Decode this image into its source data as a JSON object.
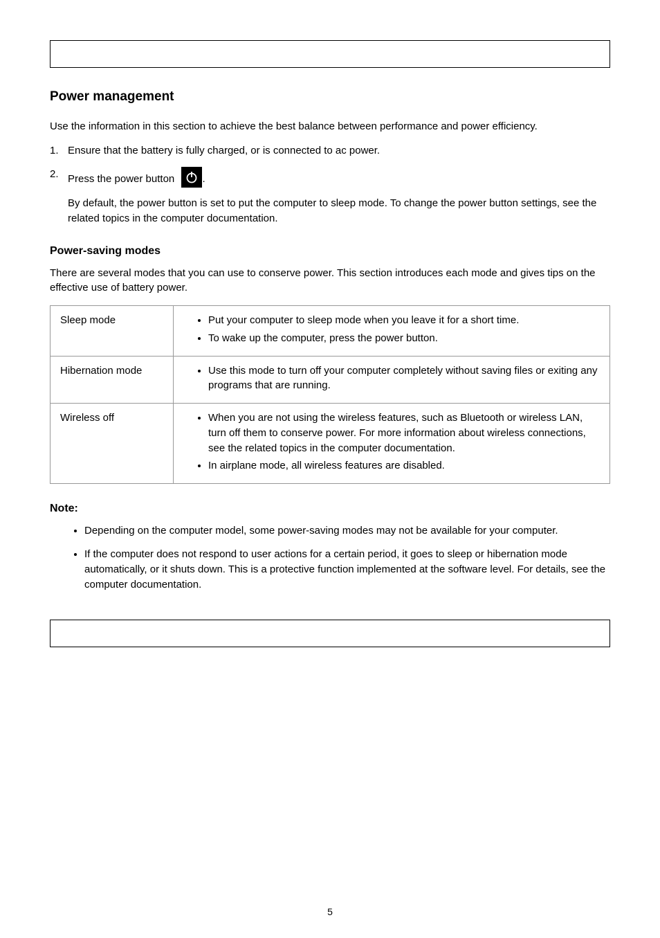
{
  "header_banner": "",
  "h1": "Power management",
  "intro": "Use the information in this section to achieve the best balance between performance and power efficiency.",
  "step1_num": "1.",
  "step1_txt": "Ensure that the battery is fully charged, or is connected to ac power.",
  "step2_num": "2.",
  "step2_label": "Press the power button ",
  "step2_tail": ".",
  "step2_indent": "By default, the power button is set to put the computer to sleep mode. To change the power button settings, see the related topics in the computer documentation.",
  "h2_modes": "Power-saving modes",
  "modes_intro": "There are several modes that you can use to conserve power. This section introduces each mode and gives tips on the effective use of battery power.",
  "table": {
    "rows": [
      {
        "label": "Sleep mode",
        "items": [
          "Put your computer to sleep mode when you leave it for a short time.",
          "To wake up the computer, press the power button."
        ]
      },
      {
        "label": "Hibernation mode",
        "items": [
          "Use this mode to turn off your computer completely without saving files or exiting any programs that are running."
        ]
      },
      {
        "label": "Wireless off",
        "items": [
          "When you are not using the wireless features, such as Bluetooth or wireless LAN, turn off them to conserve power. For more information about wireless connections, see the related topics in the computer documentation.",
          "In airplane mode, all wireless features are disabled."
        ]
      }
    ]
  },
  "h2_note": "Note:",
  "notes": [
    "Depending on the computer model, some power-saving modes may not be available for your computer.",
    "If the computer does not respond to user actions for a certain period, it goes to sleep or hibernation mode automatically, or it shuts down. This is a protective function implemented at the software level. For details, see the computer documentation."
  ],
  "footer_banner": "",
  "page_number": "5"
}
